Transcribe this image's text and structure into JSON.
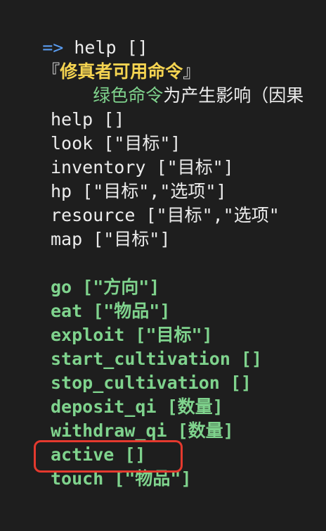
{
  "terminal": {
    "prompt_symbol": "=>",
    "command_line": " help []",
    "title_open": "『",
    "title_text": "修真者可用命令",
    "title_close": "』",
    "legend_green": "绿色命令",
    "legend_rest": "为产生影响（因果",
    "info_commands": [
      "help []",
      "look [\"目标\"]",
      "inventory [\"目标\"]",
      "hp [\"目标\",\"选项\"]",
      "resource [\"目标\",\"选项\"",
      "map [\"目标\"]"
    ],
    "action_commands": [
      "go [\"方向\"]",
      "eat [\"物品\"]",
      "exploit [\"目标\"]",
      "start_cultivation []",
      "stop_cultivation []",
      "deposit_qi [数量]",
      "withdraw_qi [数量]",
      "active []",
      "touch [\"物品\"]"
    ]
  },
  "colors": {
    "background": "#1e1e1e",
    "prompt": "#5a9cf0",
    "title": "#f5d451",
    "effect_command": "#7fd38d",
    "default_text": "#ececec",
    "highlight_border": "#e4392e"
  }
}
